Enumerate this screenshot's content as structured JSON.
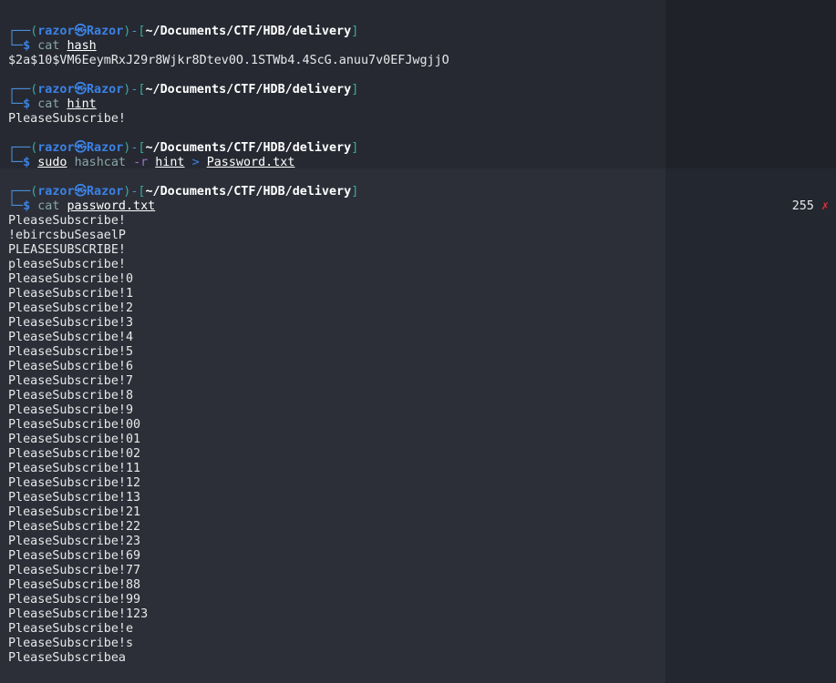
{
  "prompt": {
    "user": "razor",
    "host": "Razor",
    "at_symbol": "㉿",
    "cwd": "~/Documents/CTF/HDB/delivery",
    "dollar": "$"
  },
  "commands": [
    {
      "cmd": "cat",
      "args": [
        "hash"
      ],
      "output": [
        "$2a$10$VM6EeymRxJ29r8Wjkr8Dtev0O.1STWb4.4ScG.anuu7v0EFJwgjjO"
      ]
    },
    {
      "cmd": "cat",
      "args": [
        "hint"
      ],
      "output": [
        "PleaseSubscribe!"
      ]
    },
    {
      "cmd": "sudo",
      "cmd2": "hashcat",
      "flag": "-r",
      "arg": "hint",
      "redirect": ">",
      "outfile": "Password.txt",
      "output": []
    },
    {
      "cmd": "cat",
      "args": [
        "password.txt"
      ],
      "exit_code": "255",
      "exit_mark": "✗",
      "output": [
        "PleaseSubscribe!",
        "!ebircsbuSesaelP",
        "PLEASESUBSCRIBE!",
        "pleaseSubscribe!",
        "PleaseSubscribe!0",
        "PleaseSubscribe!1",
        "PleaseSubscribe!2",
        "PleaseSubscribe!3",
        "PleaseSubscribe!4",
        "PleaseSubscribe!5",
        "PleaseSubscribe!6",
        "PleaseSubscribe!7",
        "PleaseSubscribe!8",
        "PleaseSubscribe!9",
        "PleaseSubscribe!00",
        "PleaseSubscribe!01",
        "PleaseSubscribe!02",
        "PleaseSubscribe!11",
        "PleaseSubscribe!12",
        "PleaseSubscribe!13",
        "PleaseSubscribe!21",
        "PleaseSubscribe!22",
        "PleaseSubscribe!23",
        "PleaseSubscribe!69",
        "PleaseSubscribe!77",
        "PleaseSubscribe!88",
        "PleaseSubscribe!99",
        "PleaseSubscribe!123",
        "PleaseSubscribe!e",
        "PleaseSubscribe!s",
        "PleaseSubscribea"
      ]
    }
  ],
  "colors": {
    "prompt_blue": "#3b82e6",
    "bracket_teal": "#3aa99f",
    "flag_purple": "#a070c8",
    "error_red": "#e0303a"
  }
}
